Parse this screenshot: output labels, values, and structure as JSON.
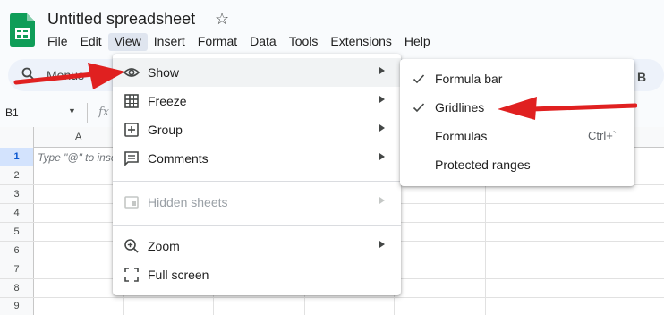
{
  "app": {
    "title": "Untitled spreadsheet",
    "star_icon": "star-icon",
    "logo_icon": "sheets-logo-icon"
  },
  "menubar": [
    "File",
    "Edit",
    "View",
    "Insert",
    "Format",
    "Data",
    "Tools",
    "Extensions",
    "Help"
  ],
  "active_menu": "View",
  "toolbar": {
    "search_label": "Menus",
    "search_icon": "search-icon",
    "bold_label": "B"
  },
  "formula_bar": {
    "name_box": "B1",
    "fx_label": "fx"
  },
  "grid": {
    "column_headers": [
      "A"
    ],
    "row_numbers": [
      "1",
      "2",
      "3",
      "4",
      "5",
      "6",
      "7",
      "8",
      "9"
    ],
    "selected_row": "1",
    "cell_a1_hint": "Type \"@\" to insert"
  },
  "view_menu": {
    "items": [
      {
        "label": "Show",
        "icon": "eye-icon",
        "submenu": true,
        "highlighted": true
      },
      {
        "label": "Freeze",
        "icon": "freeze-grid-icon",
        "submenu": true
      },
      {
        "label": "Group",
        "icon": "group-plus-icon",
        "submenu": true
      },
      {
        "label": "Comments",
        "icon": "comment-icon",
        "submenu": true
      },
      {
        "label": "Hidden sheets",
        "icon": "hidden-sheet-icon",
        "submenu": true,
        "disabled": true
      },
      {
        "label": "Zoom",
        "icon": "zoom-in-icon",
        "submenu": true
      },
      {
        "label": "Full screen",
        "icon": "fullscreen-icon",
        "submenu": false
      }
    ]
  },
  "show_submenu": {
    "items": [
      {
        "label": "Formula bar",
        "checked": true
      },
      {
        "label": "Gridlines",
        "checked": true
      },
      {
        "label": "Formulas",
        "checked": false,
        "shortcut": "Ctrl+`"
      },
      {
        "label": "Protected ranges",
        "checked": false
      }
    ]
  },
  "colors": {
    "annotation_arrow": "#e02020",
    "accent": "#0b57d0",
    "sheets_green": "#0f9d58"
  }
}
